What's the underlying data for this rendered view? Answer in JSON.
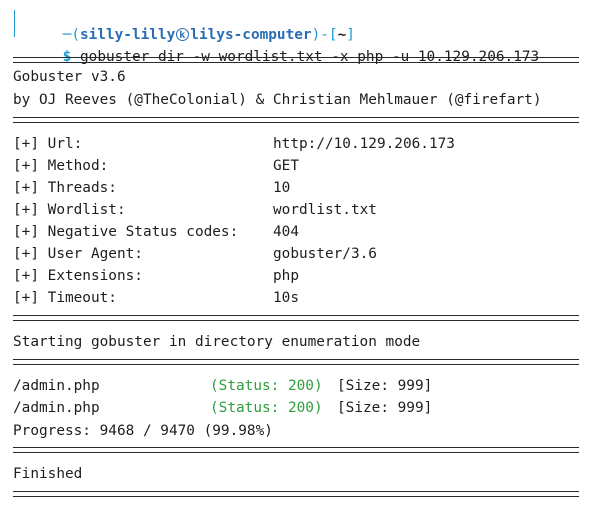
{
  "prompt": {
    "user": "silly-lilly",
    "host": "lilys-computer",
    "cwd": "~",
    "symbol": "$",
    "command": "gobuster dir -w wordlist.txt -x php -u 10.129.206.173"
  },
  "banner": {
    "title": "Gobuster v3.6",
    "authors": "by OJ Reeves (@TheColonial) & Christian Mehlmauer (@firefart)"
  },
  "config": [
    {
      "key": "[+] Url:",
      "value": "http://10.129.206.173"
    },
    {
      "key": "[+] Method:",
      "value": "GET"
    },
    {
      "key": "[+] Threads:",
      "value": "10"
    },
    {
      "key": "[+] Wordlist:",
      "value": "wordlist.txt"
    },
    {
      "key": "[+] Negative Status codes:",
      "value": "404"
    },
    {
      "key": "[+] User Agent:",
      "value": "gobuster/3.6"
    },
    {
      "key": "[+] Extensions:",
      "value": "php"
    },
    {
      "key": "[+] Timeout:",
      "value": "10s"
    }
  ],
  "mode_line": "Starting gobuster in directory enumeration mode",
  "results": [
    {
      "path": "/admin.php",
      "status": "(Status: 200)",
      "size": "[Size: 999]"
    },
    {
      "path": "/admin.php",
      "status": "(Status: 200)",
      "size": "[Size: 999]"
    }
  ],
  "progress": "Progress: 9468 / 9470 (99.98%)",
  "finished": "Finished",
  "colors": {
    "prompt_accent": "#1f9bd1",
    "user_host": "#2a6db5",
    "status": "#2e9e3e",
    "text": "#1e1e1e"
  }
}
